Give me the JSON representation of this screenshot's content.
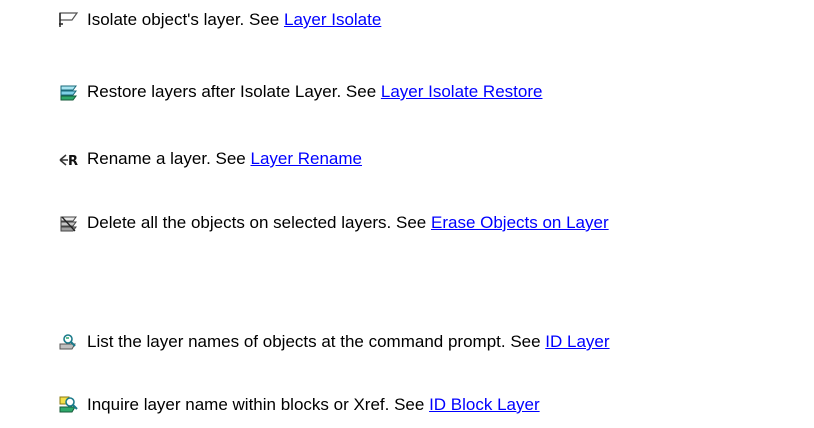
{
  "items": [
    {
      "icon": "layer-isolate-icon",
      "text": "Isolate object's layer. See ",
      "link": "Layer Isolate"
    },
    {
      "icon": "layer-isolate-restore-icon",
      "text": "Restore layers after Isolate Layer. See ",
      "link": "Layer Isolate Restore"
    },
    {
      "icon": "layer-rename-icon",
      "text": "Rename a layer. See ",
      "link": "Layer Rename"
    },
    {
      "icon": "erase-objects-on-layer-icon",
      "text": "Delete all the objects on selected layers. See ",
      "link": "Erase Objects on Layer"
    },
    {
      "icon": "id-layer-icon",
      "text": "List the layer names of objects at the command prompt. See ",
      "link": "ID Layer"
    },
    {
      "icon": "id-block-layer-icon",
      "text": "Inquire layer name within blocks or Xref. See ",
      "link": "ID Block Layer"
    }
  ],
  "colors": {
    "link": "#0000ff",
    "text": "#000000"
  }
}
